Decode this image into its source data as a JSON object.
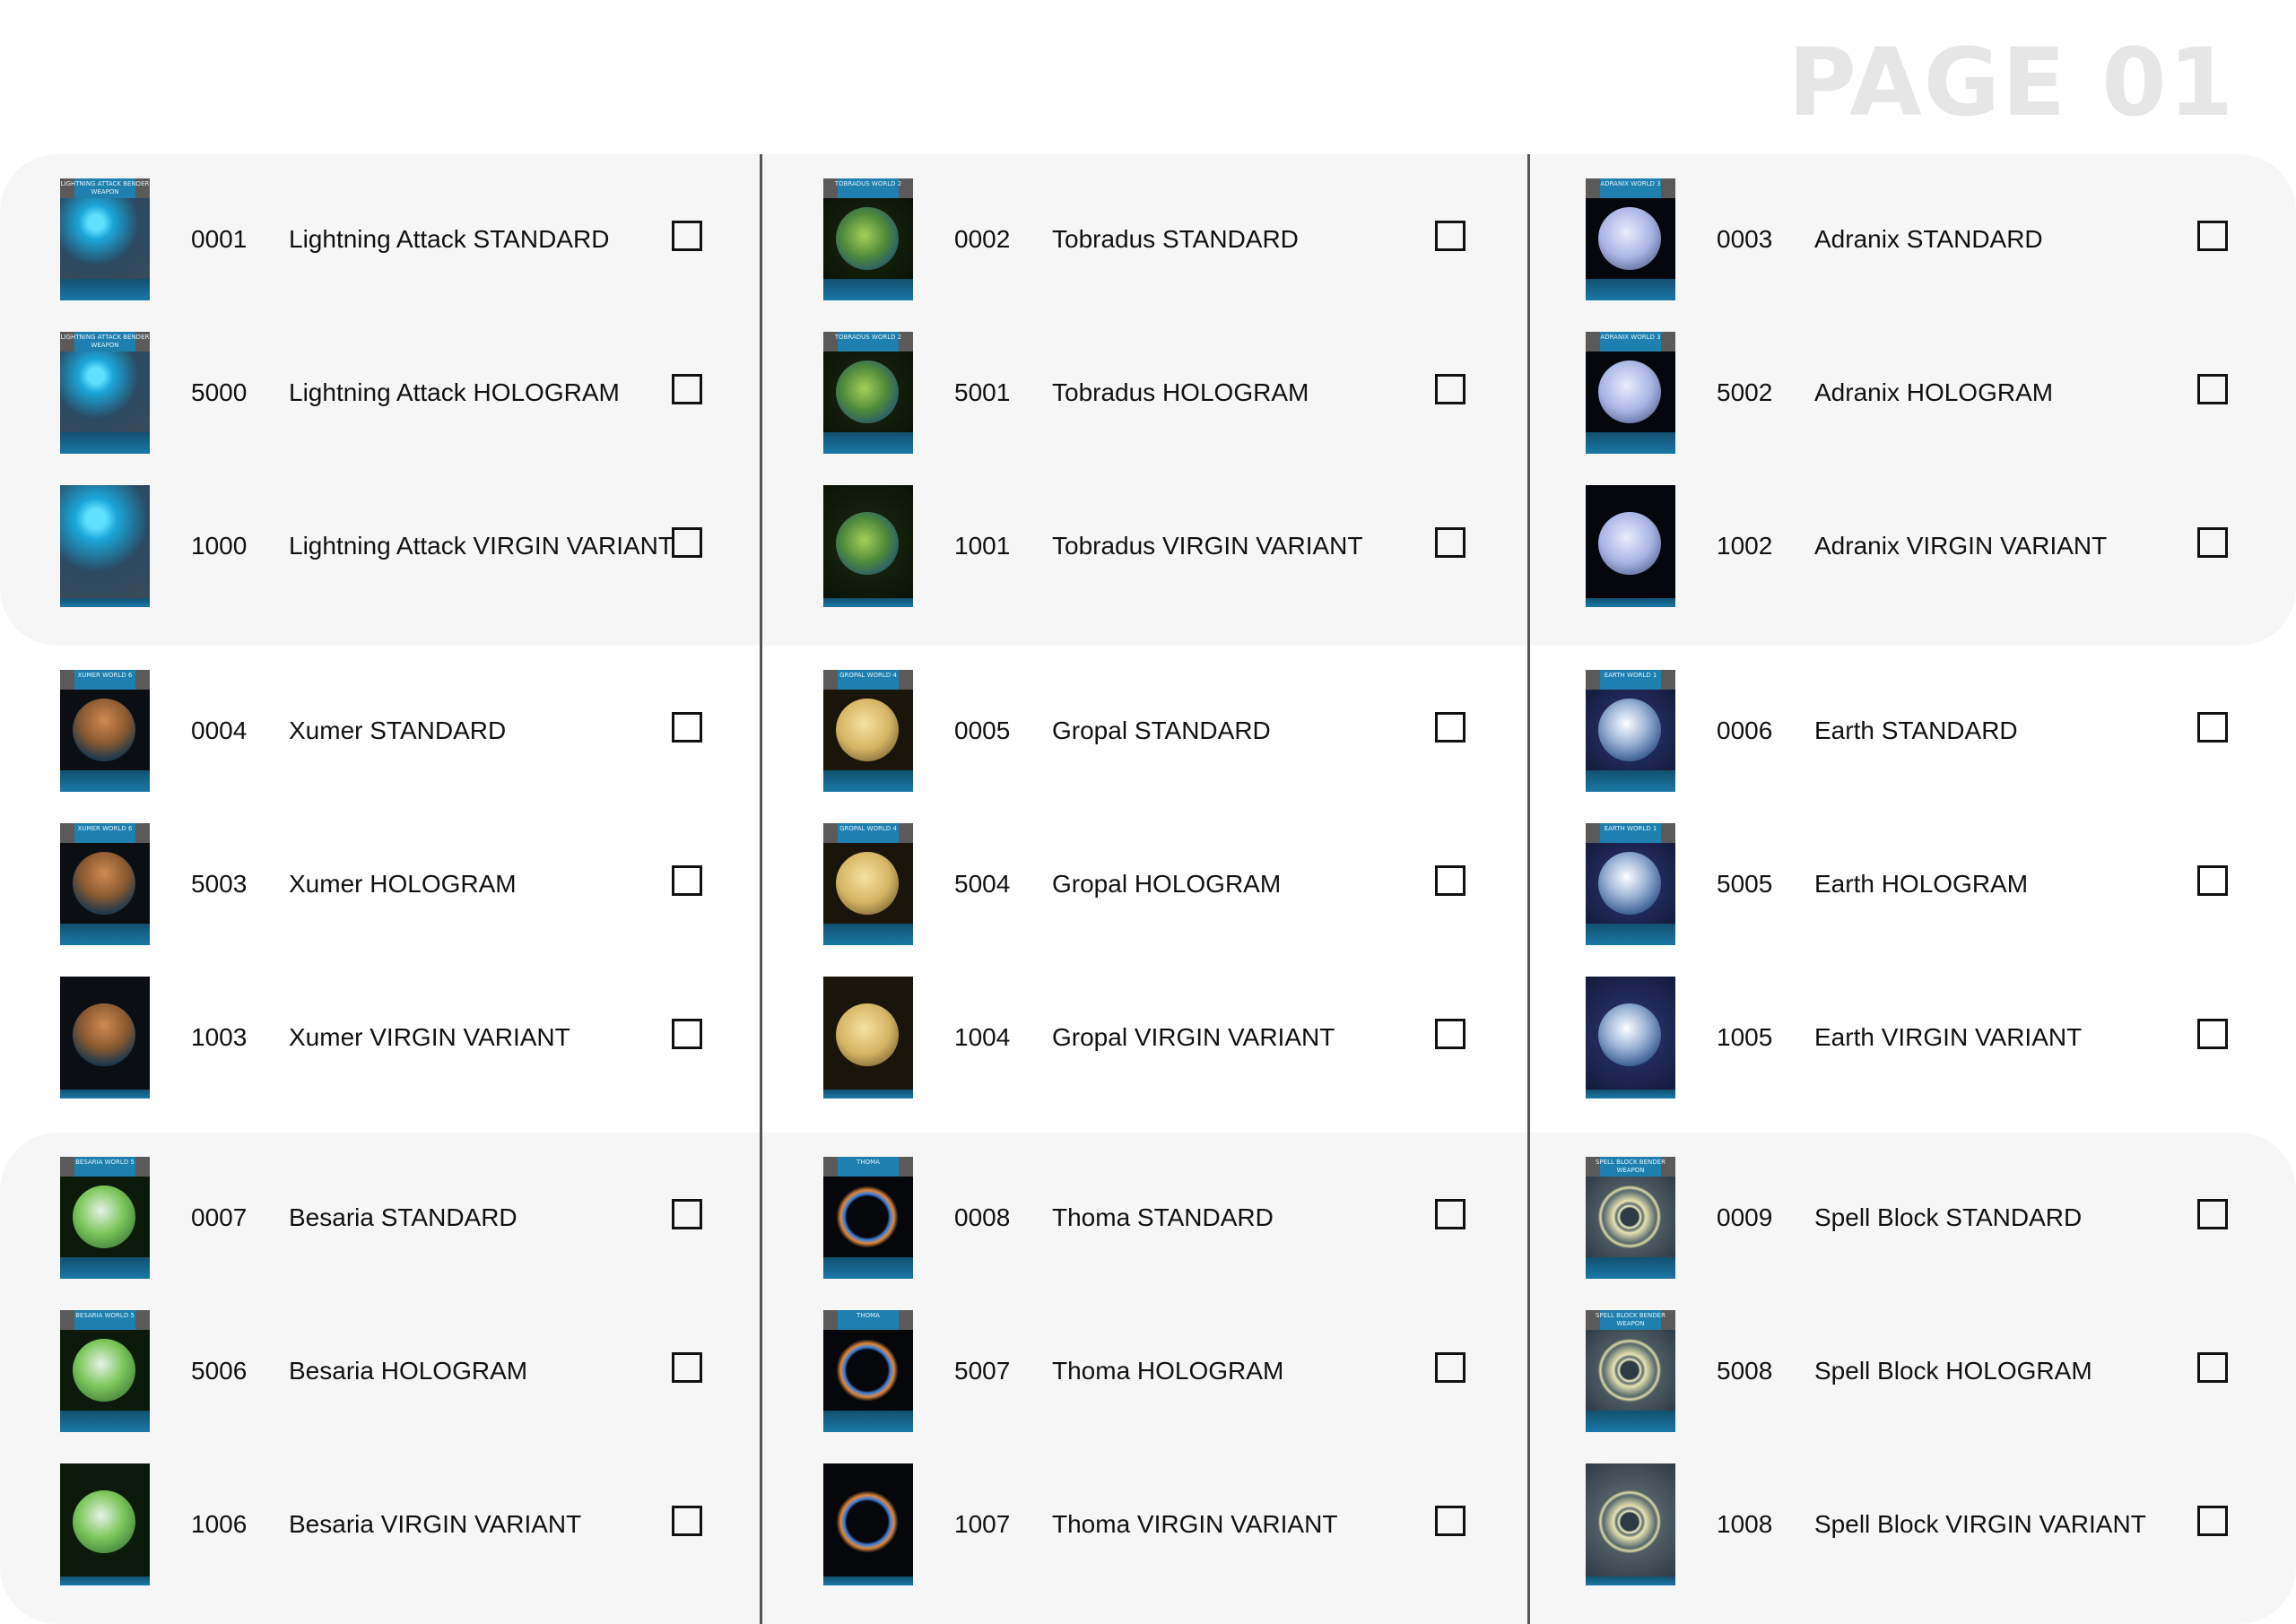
{
  "page_title": "PAGE 01",
  "groups": [
    {
      "columns": [
        {
          "card": "Lightning Attack",
          "header": "LIGHTNING ATTACK BENDER WEAPON",
          "theme": "lightning",
          "rows": [
            {
              "number": "0001",
              "name": "Lightning Attack STANDARD",
              "variant": "standard",
              "checked": false
            },
            {
              "number": "5000",
              "name": "Lightning Attack HOLOGRAM",
              "variant": "hologram",
              "checked": false
            },
            {
              "number": "1000",
              "name": "Lightning Attack VIRGIN VARIANT",
              "variant": "virgin",
              "checked": false
            }
          ]
        },
        {
          "card": "Tobradus",
          "header": "TOBRADUS WORLD 2",
          "theme": "tobradus",
          "rows": [
            {
              "number": "0002",
              "name": "Tobradus STANDARD",
              "variant": "standard",
              "checked": false
            },
            {
              "number": "5001",
              "name": "Tobradus HOLOGRAM",
              "variant": "hologram",
              "checked": false
            },
            {
              "number": "1001",
              "name": "Tobradus VIRGIN VARIANT",
              "variant": "virgin",
              "checked": false
            }
          ]
        },
        {
          "card": "Adranix",
          "header": "ADRANIX WORLD 3",
          "theme": "adranix",
          "rows": [
            {
              "number": "0003",
              "name": "Adranix STANDARD",
              "variant": "standard",
              "checked": false
            },
            {
              "number": "5002",
              "name": "Adranix HOLOGRAM",
              "variant": "hologram",
              "checked": false
            },
            {
              "number": "1002",
              "name": "Adranix VIRGIN VARIANT",
              "variant": "virgin",
              "checked": false
            }
          ]
        }
      ]
    },
    {
      "columns": [
        {
          "card": "Xumer",
          "header": "XUMER WORLD 6",
          "theme": "xumer",
          "rows": [
            {
              "number": "0004",
              "name": "Xumer STANDARD",
              "variant": "standard",
              "checked": false
            },
            {
              "number": "5003",
              "name": "Xumer HOLOGRAM",
              "variant": "hologram",
              "checked": false
            },
            {
              "number": "1003",
              "name": "Xumer VIRGIN VARIANT",
              "variant": "virgin",
              "checked": false
            }
          ]
        },
        {
          "card": "Gropal",
          "header": "GROPAL WORLD 4",
          "theme": "gropal",
          "rows": [
            {
              "number": "0005",
              "name": "Gropal STANDARD",
              "variant": "standard",
              "checked": false
            },
            {
              "number": "5004",
              "name": "Gropal HOLOGRAM",
              "variant": "hologram",
              "checked": false
            },
            {
              "number": "1004",
              "name": "Gropal VIRGIN VARIANT",
              "variant": "virgin",
              "checked": false
            }
          ]
        },
        {
          "card": "Earth",
          "header": "EARTH WORLD 1",
          "theme": "earth",
          "rows": [
            {
              "number": "0006",
              "name": "Earth STANDARD",
              "variant": "standard",
              "checked": false
            },
            {
              "number": "5005",
              "name": "Earth HOLOGRAM",
              "variant": "hologram",
              "checked": false
            },
            {
              "number": "1005",
              "name": "Earth VIRGIN VARIANT",
              "variant": "virgin",
              "checked": false
            }
          ]
        }
      ]
    },
    {
      "columns": [
        {
          "card": "Besaria",
          "header": "BESARIA WORLD 5",
          "theme": "besaria",
          "rows": [
            {
              "number": "0007",
              "name": "Besaria STANDARD",
              "variant": "standard",
              "checked": false
            },
            {
              "number": "5006",
              "name": "Besaria HOLOGRAM",
              "variant": "hologram",
              "checked": false
            },
            {
              "number": "1006",
              "name": "Besaria VIRGIN VARIANT",
              "variant": "virgin",
              "checked": false
            }
          ]
        },
        {
          "card": "Thoma",
          "header": "THOMA",
          "theme": "thoma",
          "rows": [
            {
              "number": "0008",
              "name": "Thoma STANDARD",
              "variant": "standard",
              "checked": false
            },
            {
              "number": "5007",
              "name": "Thoma HOLOGRAM",
              "variant": "hologram",
              "checked": false
            },
            {
              "number": "1007",
              "name": "Thoma VIRGIN VARIANT",
              "variant": "virgin",
              "checked": false
            }
          ]
        },
        {
          "card": "Spell Block",
          "header": "SPELL BLOCK BENDER WEAPON",
          "theme": "spellblock",
          "rows": [
            {
              "number": "0009",
              "name": "Spell Block STANDARD",
              "variant": "standard",
              "checked": false
            },
            {
              "number": "5008",
              "name": "Spell Block HOLOGRAM",
              "variant": "hologram",
              "checked": false
            },
            {
              "number": "1008",
              "name": "Spell Block VIRGIN VARIANT",
              "variant": "virgin",
              "checked": false
            }
          ]
        }
      ]
    }
  ],
  "colors": {
    "band": "#f6f6f6",
    "title": "#e6e6e6",
    "divider": "#555555",
    "card_blue": "#1f7fae"
  }
}
